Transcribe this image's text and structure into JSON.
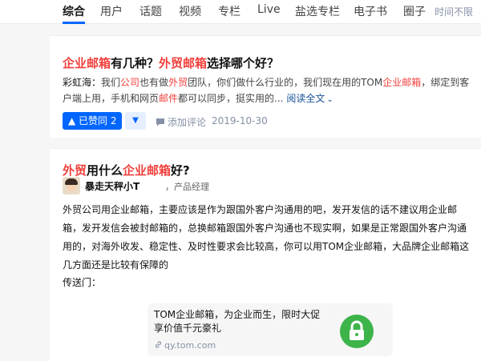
{
  "nav": {
    "tabs": [
      {
        "label": "综合"
      },
      {
        "label": "用户"
      },
      {
        "label": "话题"
      },
      {
        "label": "视频"
      },
      {
        "label": "专栏"
      },
      {
        "label": "Live"
      },
      {
        "label": "盐选专栏"
      },
      {
        "label": "电子书"
      },
      {
        "label": "圈子"
      }
    ],
    "time_filter": "时间不限",
    "active_color": "#0066ff"
  },
  "results": [
    {
      "title_parts": [
        "企业邮箱",
        "有几种？",
        "外贸邮箱",
        "选择哪个好？"
      ],
      "excerpt": {
        "author": "彩虹海：",
        "parts": [
          "我们",
          "公司",
          "也有做",
          "外贸",
          "团队，你们做什么行业的，我们现在用的TOM",
          "企业邮箱",
          "，绑定到客户端上用，手机和网页",
          "邮件",
          "都可以同步，挺实用的..."
        ],
        "read_more": "阅读全文"
      },
      "vote_label": "▲ 已赞同 2",
      "comment_label": "添加评论",
      "date": "2019-10-30"
    },
    {
      "title_parts": [
        "外贸",
        "用什么",
        "企业邮箱",
        "好?"
      ],
      "author": {
        "name": "暴走天秤小T",
        "role": "，产品经理"
      },
      "body": "外贸公司用企业邮箱，主要应该是作为跟国外客户沟通用的吧，发开发信的话不建议用企业邮箱，发开发信会被封邮箱的，总换邮箱跟国外客户沟通也不现实啊，如果是正常跟国外客户沟通用的，对海外收发、稳定性、及时性要求会比较高，你可以用TOM企业邮箱，大品牌企业邮箱这几方面还是比较有保障的",
      "portal": "传送门：",
      "link_card": {
        "title": "TOM企业邮箱，为企业而生，限时大促享价值千元豪礼",
        "url": "qy.tom.com",
        "icon": "lock-icon",
        "icon_color": "#3cb44a"
      }
    }
  ],
  "colors": {
    "highlight": "#f1403c",
    "link": "#175199"
  }
}
